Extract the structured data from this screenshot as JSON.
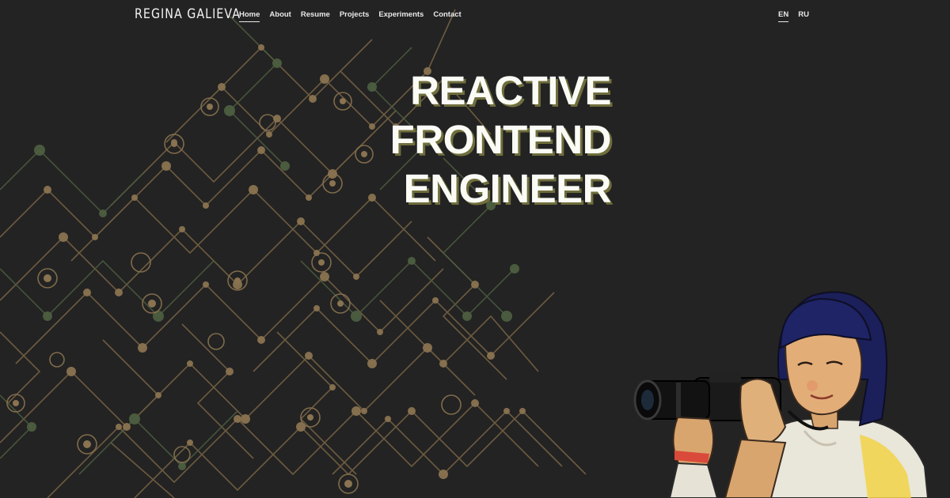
{
  "header": {
    "brand": "REGINA GALIEVA",
    "nav": [
      {
        "label": "Home",
        "active": true
      },
      {
        "label": "About",
        "active": false
      },
      {
        "label": "Resume",
        "active": false
      },
      {
        "label": "Projects",
        "active": false
      },
      {
        "label": "Experiments",
        "active": false
      },
      {
        "label": "Contact",
        "active": false
      }
    ],
    "languages": [
      {
        "label": "EN",
        "active": true
      },
      {
        "label": "RU",
        "active": false
      }
    ]
  },
  "hero": {
    "lines": [
      "REACTIVE",
      "FRONTEND",
      "ENGINEER"
    ]
  },
  "colors": {
    "background": "#232323",
    "circuit_gold": "#8a7350",
    "circuit_green": "#4a5a3e",
    "headline": "#fbfbf6",
    "headline_shadow": "#6f6e3c",
    "nav_text": "#e9e9e9"
  },
  "illustration": {
    "name": "woman-with-camera-illustration"
  }
}
